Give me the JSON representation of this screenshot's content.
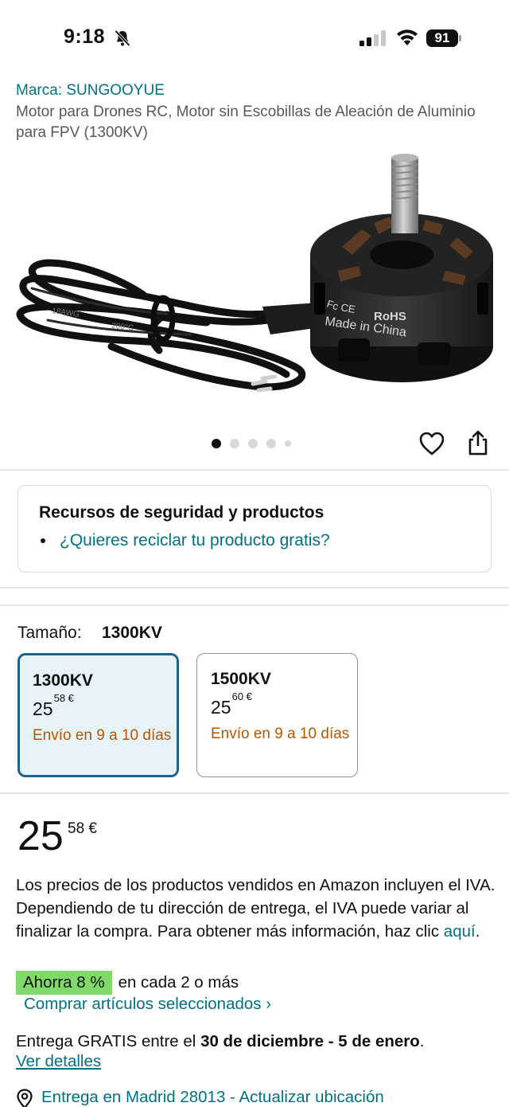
{
  "status_bar": {
    "time": "9:18",
    "battery": "91"
  },
  "header": {
    "brand": "Marca: SUNGOOYUE",
    "title": "Motor para Drones RC, Motor sin Escobillas de Aleación de Aluminio para FPV (1300KV)"
  },
  "gallery": {
    "dots_count": 5,
    "active_dot": 0,
    "image_text_lines": [
      "Fc",
      "CE",
      "RoHS",
      "Made in China",
      "18AWG",
      "200°C"
    ]
  },
  "safety": {
    "title": "Recursos de seguridad y productos",
    "link": "¿Quieres reciclar tu producto gratis?"
  },
  "variants": {
    "label": "Tamaño:",
    "selected_value": "1300KV",
    "options": [
      {
        "name": "1300KV",
        "price_whole": "25",
        "price_fraction": "58 €",
        "shipping": "Envío en 9 a 10 días",
        "selected": true
      },
      {
        "name": "1500KV",
        "price_whole": "25",
        "price_fraction": "60 €",
        "shipping": "Envío en 9 a 10 días",
        "selected": false
      }
    ]
  },
  "price": {
    "whole": "25",
    "fraction": "58 €"
  },
  "vat": {
    "text": "Los precios de los productos vendidos en Amazon incluyen el IVA. Dependiendo de tu dirección de entrega, el IVA puede variar al finalizar la compra. Para obtener más información, haz clic ",
    "link": "aquí",
    "end": "."
  },
  "promo": {
    "badge": "Ahorra 8 %",
    "tail": "en cada 2 o más",
    "link": "Comprar artículos seleccionados ›"
  },
  "delivery": {
    "prefix": "Entrega GRATIS entre el ",
    "dates": "30 de diciembre - 5 de enero",
    "end": ".",
    "details_link": "Ver detalles",
    "location_link": "Entrega en Madrid 28013 - Actualizar ubicación"
  },
  "colors": {
    "link": "#007185",
    "shipping": "#b75600",
    "save_badge": "#7fda6a",
    "selected_border": "#21628d",
    "selected_bg": "#e6f3f8"
  }
}
